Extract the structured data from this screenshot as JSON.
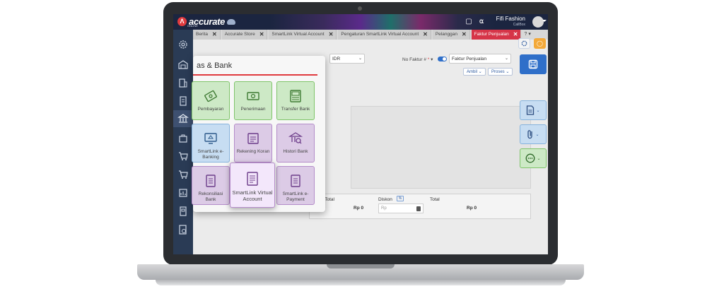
{
  "app": {
    "logo_text": "accurate",
    "logo_sub": "ONLINE",
    "user_name": "Fifi Fashion",
    "user_sub": "CallBox"
  },
  "tabs": [
    {
      "label": "Berita",
      "active": false
    },
    {
      "label": "Accurate Store",
      "active": false
    },
    {
      "label": "SmartLink Virtual Account",
      "active": false
    },
    {
      "label": "Pengaturan SmartLink Virtual Account",
      "active": false
    },
    {
      "label": "Pelanggan",
      "active": false
    },
    {
      "label": "Faktur Penjualan",
      "active": true
    }
  ],
  "tab_more": "? ▾",
  "form": {
    "currency": "IDR",
    "no_faktur_label": "No Faktur #",
    "no_faktur_required": "*",
    "faktur_type": "Faktur Penjualan",
    "ambil_label": "Ambil",
    "proses_label": "Proses",
    "sub_total_label": "Sub Total",
    "sub_total_value": "Rp 0",
    "diskon_label": "Diskon",
    "diskon_badge": "%",
    "diskon_placeholder": "Rp",
    "total_label": "Total",
    "total_value": "Rp 0"
  },
  "modal": {
    "title": "as & Bank",
    "tiles": [
      {
        "label": "Pembayaran",
        "color": "green",
        "icon": "payment-icon"
      },
      {
        "label": "Penerimaan",
        "color": "green",
        "icon": "receipt-cash-icon"
      },
      {
        "label": "Transfer Bank",
        "color": "green",
        "icon": "atm-transfer-icon"
      },
      {
        "label": "SmartLink e-Banking",
        "color": "blue",
        "icon": "ebanking-icon"
      },
      {
        "label": "Rekening Koran",
        "color": "purple",
        "icon": "bank-statement-icon"
      },
      {
        "label": "Histori Bank",
        "color": "purple",
        "icon": "bank-history-icon"
      },
      {
        "label": "Rekonsiliasi Bank",
        "color": "purple",
        "icon": "reconciliation-icon"
      },
      {
        "label": "SmartLink Virtual Account",
        "color": "purple",
        "icon": "virtual-account-icon",
        "highlighted": true
      },
      {
        "label": "SmartLink e-Payment",
        "color": "purple",
        "icon": "epayment-icon"
      }
    ]
  },
  "colors": {
    "accent_red": "#e03a3e",
    "sidebar": "#2a3b55",
    "save_blue": "#2f6fc9",
    "tile_green": "#cde9c6",
    "tile_purple": "#dccbe6",
    "tile_blue": "#c7ddf2"
  }
}
